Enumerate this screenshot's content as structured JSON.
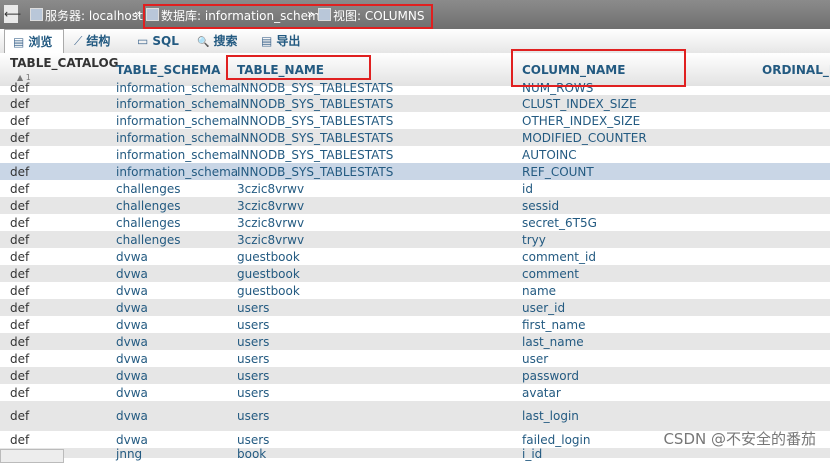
{
  "breadcrumb": {
    "server": "服务器: localhost",
    "sep1": "»",
    "database": "数据库: information_schema",
    "sep2": "»",
    "view": "视图: COLUMNS"
  },
  "tabs": [
    {
      "label": "浏览",
      "icon": "table-browse-icon",
      "glyph": "▤"
    },
    {
      "label": "结构",
      "icon": "structure-icon",
      "glyph": "⟋"
    },
    {
      "label": "SQL",
      "icon": "sql-icon",
      "glyph": "▭"
    },
    {
      "label": "搜索",
      "icon": "search-icon",
      "glyph": "🔍"
    },
    {
      "label": "导出",
      "icon": "export-icon",
      "glyph": "▤"
    }
  ],
  "columns": {
    "catalog": "TABLE_CATALOG",
    "sort_indicator": "1",
    "schema": "TABLE_SCHEMA",
    "table_name": "TABLE_NAME",
    "column_name": "COLUMN_NAME",
    "ordinal": "ORDINAL_PO"
  },
  "rows": [
    [
      "def",
      "information_schema",
      "INNODB_SYS_TABLESTATS",
      "NUM_ROWS"
    ],
    [
      "def",
      "information_schema",
      "INNODB_SYS_TABLESTATS",
      "CLUST_INDEX_SIZE"
    ],
    [
      "def",
      "information_schema",
      "INNODB_SYS_TABLESTATS",
      "OTHER_INDEX_SIZE"
    ],
    [
      "def",
      "information_schema",
      "INNODB_SYS_TABLESTATS",
      "MODIFIED_COUNTER"
    ],
    [
      "def",
      "information_schema",
      "INNODB_SYS_TABLESTATS",
      "AUTOINC"
    ],
    [
      "def",
      "information_schema",
      "INNODB_SYS_TABLESTATS",
      "REF_COUNT"
    ],
    [
      "def",
      "challenges",
      "3czic8vrwv",
      "id"
    ],
    [
      "def",
      "challenges",
      "3czic8vrwv",
      "sessid"
    ],
    [
      "def",
      "challenges",
      "3czic8vrwv",
      "secret_6T5G"
    ],
    [
      "def",
      "challenges",
      "3czic8vrwv",
      "tryy"
    ],
    [
      "def",
      "dvwa",
      "guestbook",
      "comment_id"
    ],
    [
      "def",
      "dvwa",
      "guestbook",
      "comment"
    ],
    [
      "def",
      "dvwa",
      "guestbook",
      "name"
    ],
    [
      "def",
      "dvwa",
      "users",
      "user_id"
    ],
    [
      "def",
      "dvwa",
      "users",
      "first_name"
    ],
    [
      "def",
      "dvwa",
      "users",
      "last_name"
    ],
    [
      "def",
      "dvwa",
      "users",
      "user"
    ],
    [
      "def",
      "dvwa",
      "users",
      "password"
    ],
    [
      "def",
      "dvwa",
      "users",
      "avatar"
    ],
    [
      "def",
      "dvwa",
      "users",
      "last_login"
    ],
    [
      "def",
      "dvwa",
      "users",
      "failed_login"
    ],
    [
      "",
      "jnng",
      "book",
      "i_id"
    ]
  ],
  "watermark": "CSDN @不安全的番茄",
  "colors": {
    "link": "#235a81",
    "highlight_row": "#c9d6e6",
    "annotation_box": "#e02020"
  }
}
